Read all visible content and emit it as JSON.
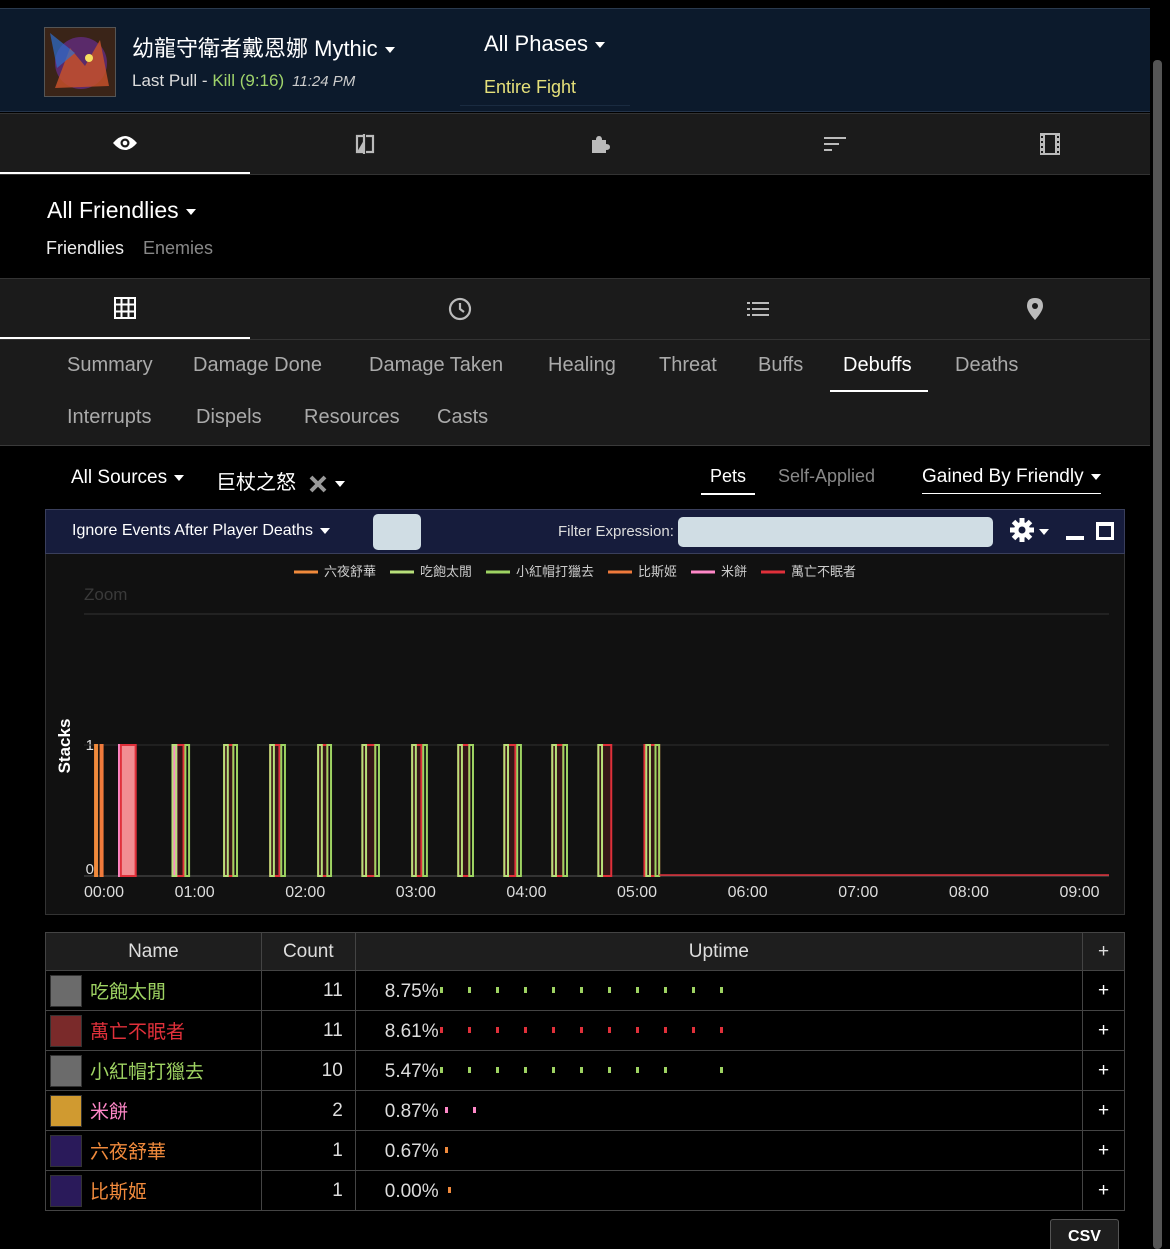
{
  "header": {
    "boss_name": "幼龍守衛者戴恩娜 Mythic",
    "last_pull_label": "Last Pull - ",
    "kill_text": "Kill (9:16)",
    "kill_time": "11:24 PM",
    "phase": "All Phases",
    "phase_sub": "Entire Fight"
  },
  "top_tabs": [
    "eye-icon",
    "compare-icon",
    "puzzle-icon",
    "sort-icon",
    "film-icon"
  ],
  "friendlies": {
    "title": "All Friendlies",
    "tab_friendlies": "Friendlies",
    "tab_enemies": "Enemies"
  },
  "view_tabs": [
    "grid-icon",
    "clock-icon",
    "list-icon",
    "map-pin-icon"
  ],
  "subtabs": {
    "row1": [
      "Summary",
      "Damage Done",
      "Damage Taken",
      "Healing",
      "Threat",
      "Buffs",
      "Debuffs",
      "Deaths"
    ],
    "row2": [
      "Interrupts",
      "Dispels",
      "Resources",
      "Casts"
    ],
    "active": "Debuffs"
  },
  "filters": {
    "sources": "All Sources",
    "ability": "巨杖之怒",
    "pets": "Pets",
    "self_applied": "Self-Applied",
    "gained_by": "Gained By Friendly"
  },
  "toolbar": {
    "ignore_events": "Ignore Events After Player Deaths",
    "filter_label": "Filter Expression:",
    "filter_value": ""
  },
  "chart_data": {
    "type": "line",
    "zoom_label": "Zoom",
    "ylabel": "Stacks",
    "ylim": [
      0,
      1
    ],
    "yticks": [
      "0",
      "1"
    ],
    "xlim": [
      0,
      556
    ],
    "xticks": [
      "00:00",
      "01:00",
      "02:00",
      "03:00",
      "04:00",
      "05:00",
      "06:00",
      "07:00",
      "08:00",
      "09:00"
    ],
    "series": [
      {
        "name": "六夜舒華",
        "color": "#f08a3c",
        "intervals": [
          [
            6,
            7
          ]
        ]
      },
      {
        "name": "吃飽太閒",
        "color": "#b8e07a",
        "intervals": [
          [
            48,
            50
          ],
          [
            76,
            78
          ],
          [
            101,
            103
          ],
          [
            127,
            129
          ],
          [
            151,
            153
          ],
          [
            178,
            180
          ],
          [
            203,
            205
          ],
          [
            228,
            230
          ],
          [
            254,
            256
          ],
          [
            279,
            281
          ],
          [
            305,
            307
          ]
        ]
      },
      {
        "name": "小紅帽打獵去",
        "color": "#9ed362",
        "intervals": [
          [
            55,
            57
          ],
          [
            81,
            83
          ],
          [
            107,
            109
          ],
          [
            132,
            134
          ],
          [
            158,
            160
          ],
          [
            184,
            186
          ],
          [
            209,
            211
          ],
          [
            235,
            237
          ],
          [
            260,
            262
          ],
          [
            310,
            312
          ]
        ]
      },
      {
        "name": "比斯姬",
        "color": "#f07a3c",
        "intervals": [
          [
            9,
            10
          ]
        ]
      },
      {
        "name": "米餅",
        "color": "#ff88c8",
        "intervals": [
          [
            19,
            21
          ],
          [
            49,
            50
          ]
        ]
      },
      {
        "name": "萬亡不眠者",
        "color": "#e0303a",
        "intervals": [
          [
            19,
            28
          ],
          [
            48,
            54
          ],
          [
            76,
            81
          ],
          [
            101,
            106
          ],
          [
            127,
            132
          ],
          [
            151,
            158
          ],
          [
            178,
            183
          ],
          [
            203,
            209
          ],
          [
            228,
            234
          ],
          [
            254,
            260
          ],
          [
            279,
            286
          ],
          [
            304,
            312
          ]
        ]
      }
    ]
  },
  "table": {
    "headers": [
      "Name",
      "Count",
      "Uptime",
      "+"
    ],
    "rows": [
      {
        "name": "吃飽太閒",
        "color": "#9ed362",
        "count": "11",
        "uptime": "8.75%",
        "icon": "warrior-icon",
        "iconbg": "#6b6b6b",
        "ticks": [
          0.0,
          0.05,
          0.1,
          0.15,
          0.2,
          0.25,
          0.3,
          0.35,
          0.4,
          0.45,
          0.5
        ]
      },
      {
        "name": "萬亡不眠者",
        "color": "#e0303a",
        "count": "11",
        "uptime": "8.61%",
        "icon": "deathknight-icon",
        "iconbg": "#7a2a2a",
        "ticks": [
          0.0,
          0.05,
          0.1,
          0.15,
          0.2,
          0.25,
          0.3,
          0.35,
          0.4,
          0.45,
          0.5
        ]
      },
      {
        "name": "小紅帽打獵去",
        "color": "#9ed362",
        "count": "10",
        "uptime": "5.47%",
        "icon": "warrior2-icon",
        "iconbg": "#6b6b6b",
        "ticks": [
          0.0,
          0.05,
          0.1,
          0.15,
          0.2,
          0.25,
          0.3,
          0.35,
          0.4,
          0.5
        ]
      },
      {
        "name": "米餅",
        "color": "#ff88c8",
        "count": "2",
        "uptime": "0.87%",
        "icon": "paladin-icon",
        "iconbg": "#d09a30",
        "ticks": [
          0.01,
          0.06
        ]
      },
      {
        "name": "六夜舒華",
        "color": "#f08a3c",
        "count": "1",
        "uptime": "0.67%",
        "icon": "druid-icon",
        "iconbg": "#2a1a5a",
        "ticks": [
          0.01
        ]
      },
      {
        "name": "比斯姬",
        "color": "#f08a3c",
        "count": "1",
        "uptime": "0.00%",
        "icon": "druid2-icon",
        "iconbg": "#2a1a5a",
        "ticks": [
          0.015
        ]
      }
    ],
    "csv_label": "CSV"
  }
}
